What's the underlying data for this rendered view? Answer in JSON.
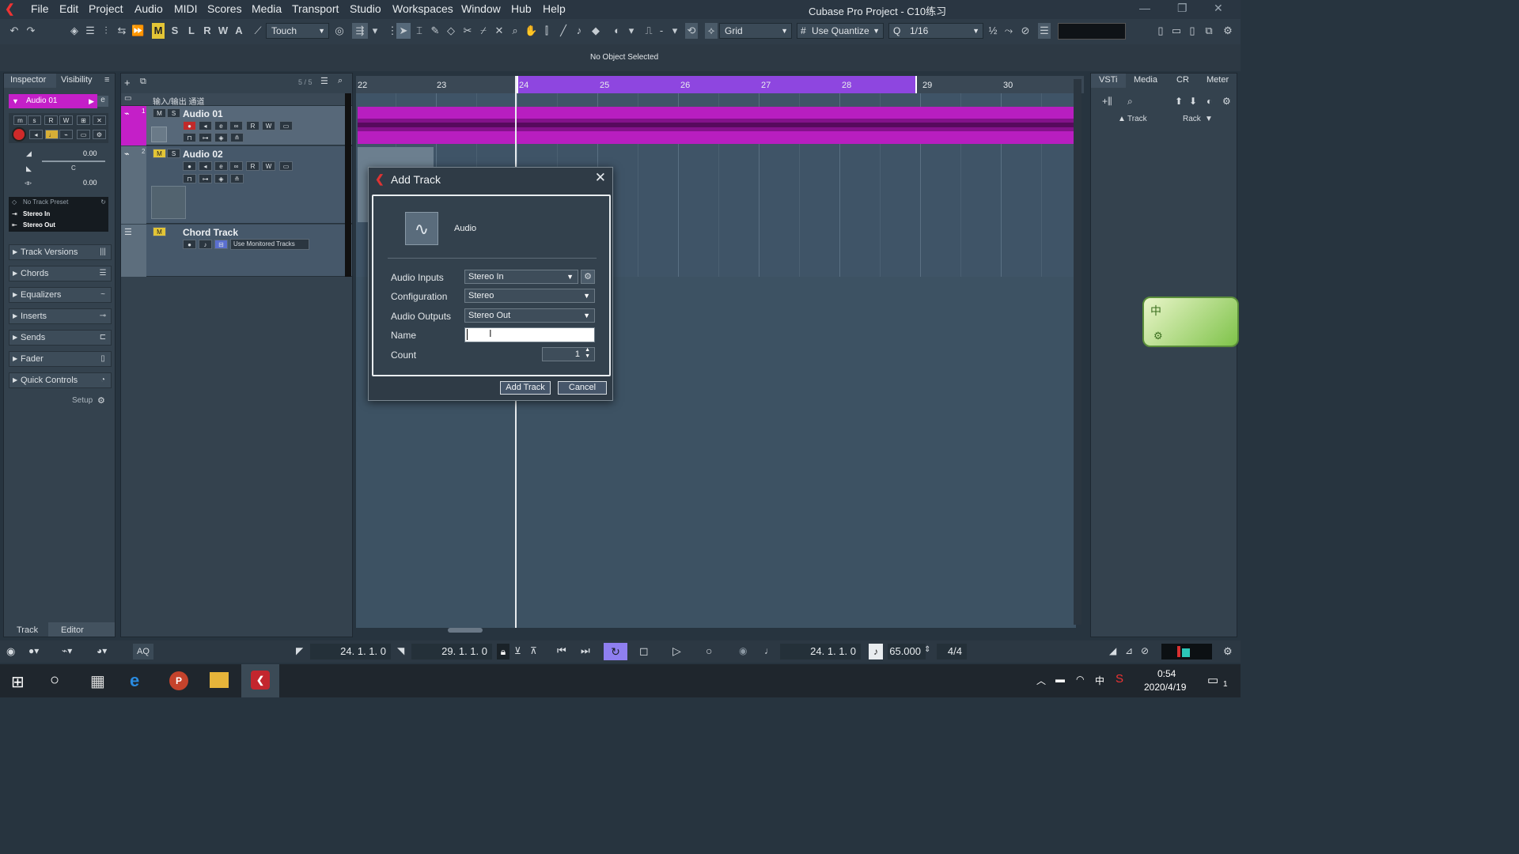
{
  "window": {
    "title": "Cubase Pro Project - C10练习",
    "menu": [
      "File",
      "Edit",
      "Project",
      "Audio",
      "MIDI",
      "Scores",
      "Media",
      "Transport",
      "Studio",
      "Workspaces",
      "Window",
      "Hub",
      "Help"
    ]
  },
  "toolbar": {
    "automation_mode": "Touch",
    "snap_type": "Grid",
    "quantize_mode": "Use Quantize",
    "quantize_value": "1/16",
    "mode_letters": [
      "M",
      "S",
      "L",
      "R",
      "W",
      "A"
    ]
  },
  "status": {
    "selection": "No Object Selected"
  },
  "inspector": {
    "tabs": [
      "Inspector",
      "Visibility"
    ],
    "track_name": "Audio 01",
    "volume": "0.00",
    "pan": "C",
    "delay": "0.00",
    "preset": "No Track Preset",
    "input": "Stereo In",
    "output": "Stereo Out",
    "sections": [
      "Track Versions",
      "Chords",
      "Equalizers",
      "Inserts",
      "Sends",
      "Fader",
      "Quick Controls"
    ],
    "setup": "Setup",
    "bottom_tabs": [
      "Track",
      "Editor"
    ]
  },
  "tracklist": {
    "counter": "5 / 5",
    "folder_name": "输入/输出 通道",
    "tracks": [
      {
        "num": "1",
        "name": "Audio 01"
      },
      {
        "num": "2",
        "name": "Audio 02"
      },
      {
        "num": "",
        "name": "Chord Track",
        "option": "Use Monitored Tracks"
      }
    ]
  },
  "ruler": {
    "bars": [
      "22",
      "23",
      "24",
      "25",
      "26",
      "27",
      "28",
      "29",
      "30"
    ]
  },
  "rightzone": {
    "tabs": [
      "VSTi",
      "Media",
      "CR",
      "Meter"
    ],
    "columns": [
      "Track",
      "Rack"
    ]
  },
  "dialog": {
    "title": "Add Track",
    "track_type": "Audio",
    "labels": {
      "inputs": "Audio Inputs",
      "configuration": "Configuration",
      "outputs": "Audio Outputs",
      "name": "Name",
      "count": "Count"
    },
    "values": {
      "inputs": "Stereo In",
      "configuration": "Stereo",
      "outputs": "Stereo Out",
      "name": "",
      "count": "1"
    },
    "buttons": {
      "add": "Add Track",
      "cancel": "Cancel"
    }
  },
  "transport": {
    "left_locator": "24. 1. 1.   0",
    "right_locator": "29. 1. 1.   0",
    "position": "24. 1. 1.   0",
    "tempo": "65.000",
    "signature": "4/4",
    "aq": "AQ"
  },
  "taskbar": {
    "time": "0:54",
    "date": "2020/4/19",
    "ime": "中",
    "notifications": "1"
  },
  "colors": {
    "accent": "#c41fc8",
    "background": "#3f5467",
    "toolbar": "#2f3c48"
  }
}
